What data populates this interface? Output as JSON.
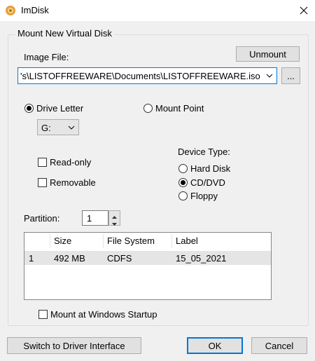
{
  "window": {
    "title": "ImDisk",
    "icon": "imdisk-app-icon",
    "close_icon": "close-icon"
  },
  "group": {
    "legend": "Mount New Virtual Disk"
  },
  "image_file": {
    "label": "Image File:",
    "value": "'s\\LISTOFFREEWARE\\Documents\\LISTOFFREEWARE.iso",
    "browse_label": "...",
    "unmount_label": "Unmount"
  },
  "mount_target": {
    "drive_letter_label": "Drive Letter",
    "drive_letter_selected": true,
    "mount_point_label": "Mount Point",
    "drive_letter_value": "G:"
  },
  "options": {
    "readonly_label": "Read-only",
    "removable_label": "Removable",
    "readonly_checked": false,
    "removable_checked": false
  },
  "device_type": {
    "label": "Device Type:",
    "options": [
      "Hard Disk",
      "CD/DVD",
      "Floppy"
    ],
    "selected": "CD/DVD"
  },
  "partition": {
    "label": "Partition:",
    "value": "1"
  },
  "partitions_table": {
    "columns": [
      "",
      "Size",
      "File System",
      "Label"
    ],
    "rows": [
      [
        "1",
        "492 MB",
        "CDFS",
        "15_05_2021"
      ]
    ]
  },
  "startup": {
    "label": "Mount at Windows Startup",
    "checked": false
  },
  "footer": {
    "switch_label": "Switch to Driver Interface",
    "ok_label": "OK",
    "cancel_label": "Cancel"
  }
}
